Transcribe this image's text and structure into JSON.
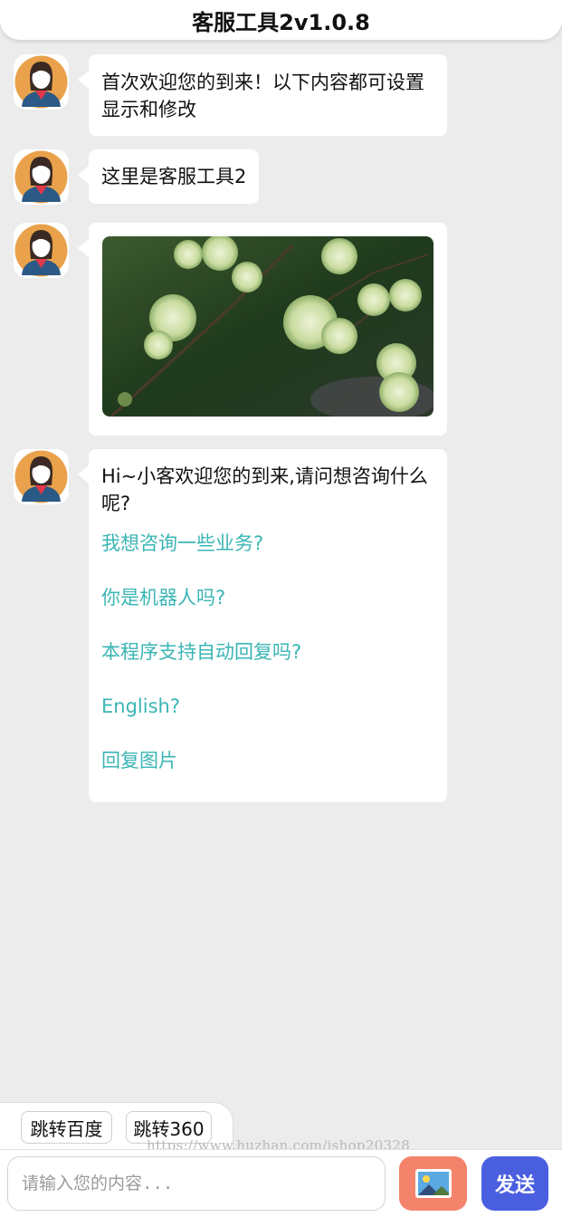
{
  "header": {
    "title": "客服工具2v1.0.8"
  },
  "messages": {
    "m1": "首次欢迎您的到来！以下内容都可设置显示和修改",
    "m2": "这里是客服工具2",
    "m4": {
      "text": "Hi~小客欢迎您的到来,请问想咨询什么呢?",
      "options": [
        "我想咨询一些业务?",
        "你是机器人吗?",
        "本程序支持自动回复吗?",
        "English?",
        "回复图片"
      ]
    }
  },
  "quick_replies": [
    "跳转百度",
    "跳转360"
  ],
  "watermark": "https://www.huzhan.com/ishop20328",
  "input": {
    "placeholder": "请输入您的内容..."
  },
  "buttons": {
    "image_icon": "image-upload-icon",
    "send_label": "发送"
  },
  "colors": {
    "background": "#ececec",
    "link": "#3bb5b5",
    "image_button": "#f4836b",
    "send_button": "#4a5fe0"
  }
}
